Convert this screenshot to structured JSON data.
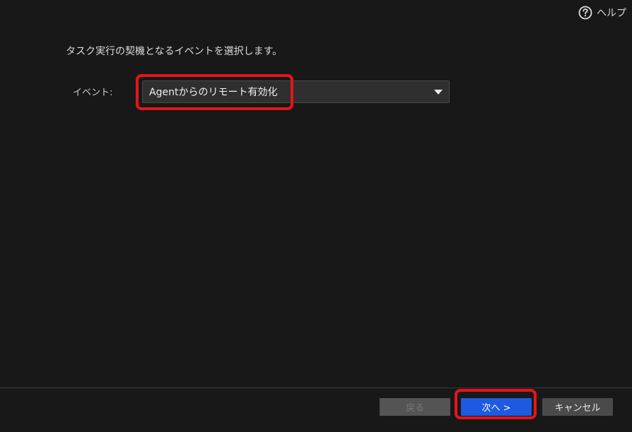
{
  "header": {
    "help_label": "ヘルプ",
    "help_icon": "question-circle-icon"
  },
  "main": {
    "instruction": "タスク実行の契機となるイベントを選択します。",
    "event_label": "イベント:",
    "event_select": {
      "selected_value": "Agentからのリモート有効化",
      "icon": "caret-down-icon"
    }
  },
  "footer": {
    "back_label": "戻る",
    "next_label": "次へ >",
    "cancel_label": "キャンセル"
  },
  "colors": {
    "background": "#181818",
    "primary_button": "#1e5ae0",
    "highlight": "#e8141a"
  }
}
